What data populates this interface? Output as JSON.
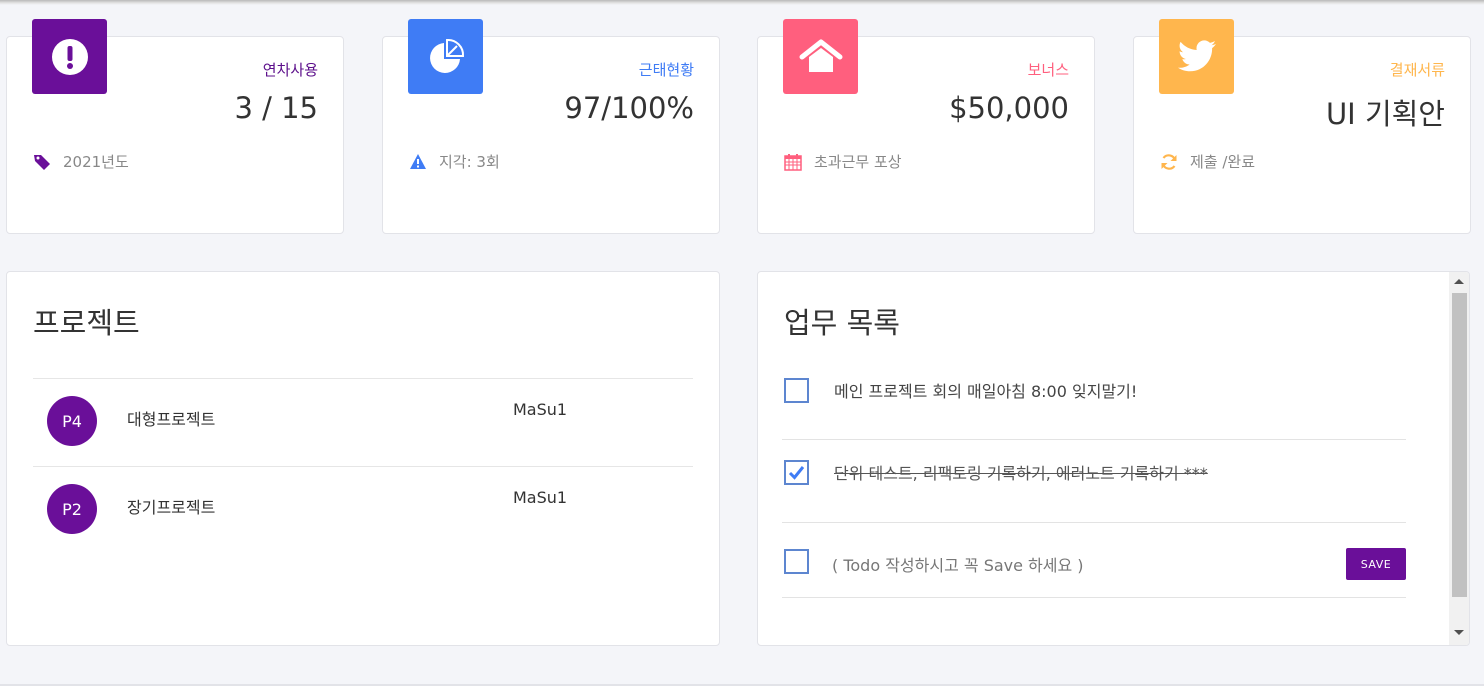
{
  "colors": {
    "purple": "#6a0f99",
    "blue": "#3f7cf5",
    "pink": "#ff5f7e",
    "orange": "#ffb64d",
    "card_title_purple": "#5c0f8b",
    "card_title_blue": "#3f7cf5",
    "card_title_pink": "#ff5f7e",
    "card_title_orange": "#ffb64d"
  },
  "stats": [
    {
      "icon": "exclamation-icon",
      "title": "연차사용",
      "value": "3 / 15",
      "footer_icon": "tag-icon",
      "footer": "2021년도"
    },
    {
      "icon": "pie-chart-icon",
      "title": "근태현황",
      "value": "97/100%",
      "footer_icon": "warning-icon",
      "footer": "지각: 3회"
    },
    {
      "icon": "home-icon",
      "title": "보너스",
      "value": "$50,000",
      "footer_icon": "calendar-icon",
      "footer": "초과근무 포상"
    },
    {
      "icon": "twitter-icon",
      "title": "결재서류",
      "value": "UI 기획안",
      "footer_icon": "refresh-icon",
      "footer": "제출 /완료"
    }
  ],
  "projects": {
    "title": "프로젝트",
    "rows": [
      {
        "avatar": "P4",
        "name": "대형프로젝트",
        "owner": "MaSu1"
      },
      {
        "avatar": "P2",
        "name": "장기프로젝트",
        "owner": "MaSu1"
      }
    ]
  },
  "todos": {
    "title": "업무 목록",
    "items": [
      {
        "text": "메인 프로젝트 회의 매일아침 8:00 잊지말기!",
        "checked": false
      },
      {
        "text": "단위 테스트, 리팩토링 기록하기, 에러노트 기록하기 ***",
        "checked": true
      }
    ],
    "new_placeholder": "( Todo 작성하시고 꼭 Save 하세요 )",
    "save_label": "SAVE"
  }
}
